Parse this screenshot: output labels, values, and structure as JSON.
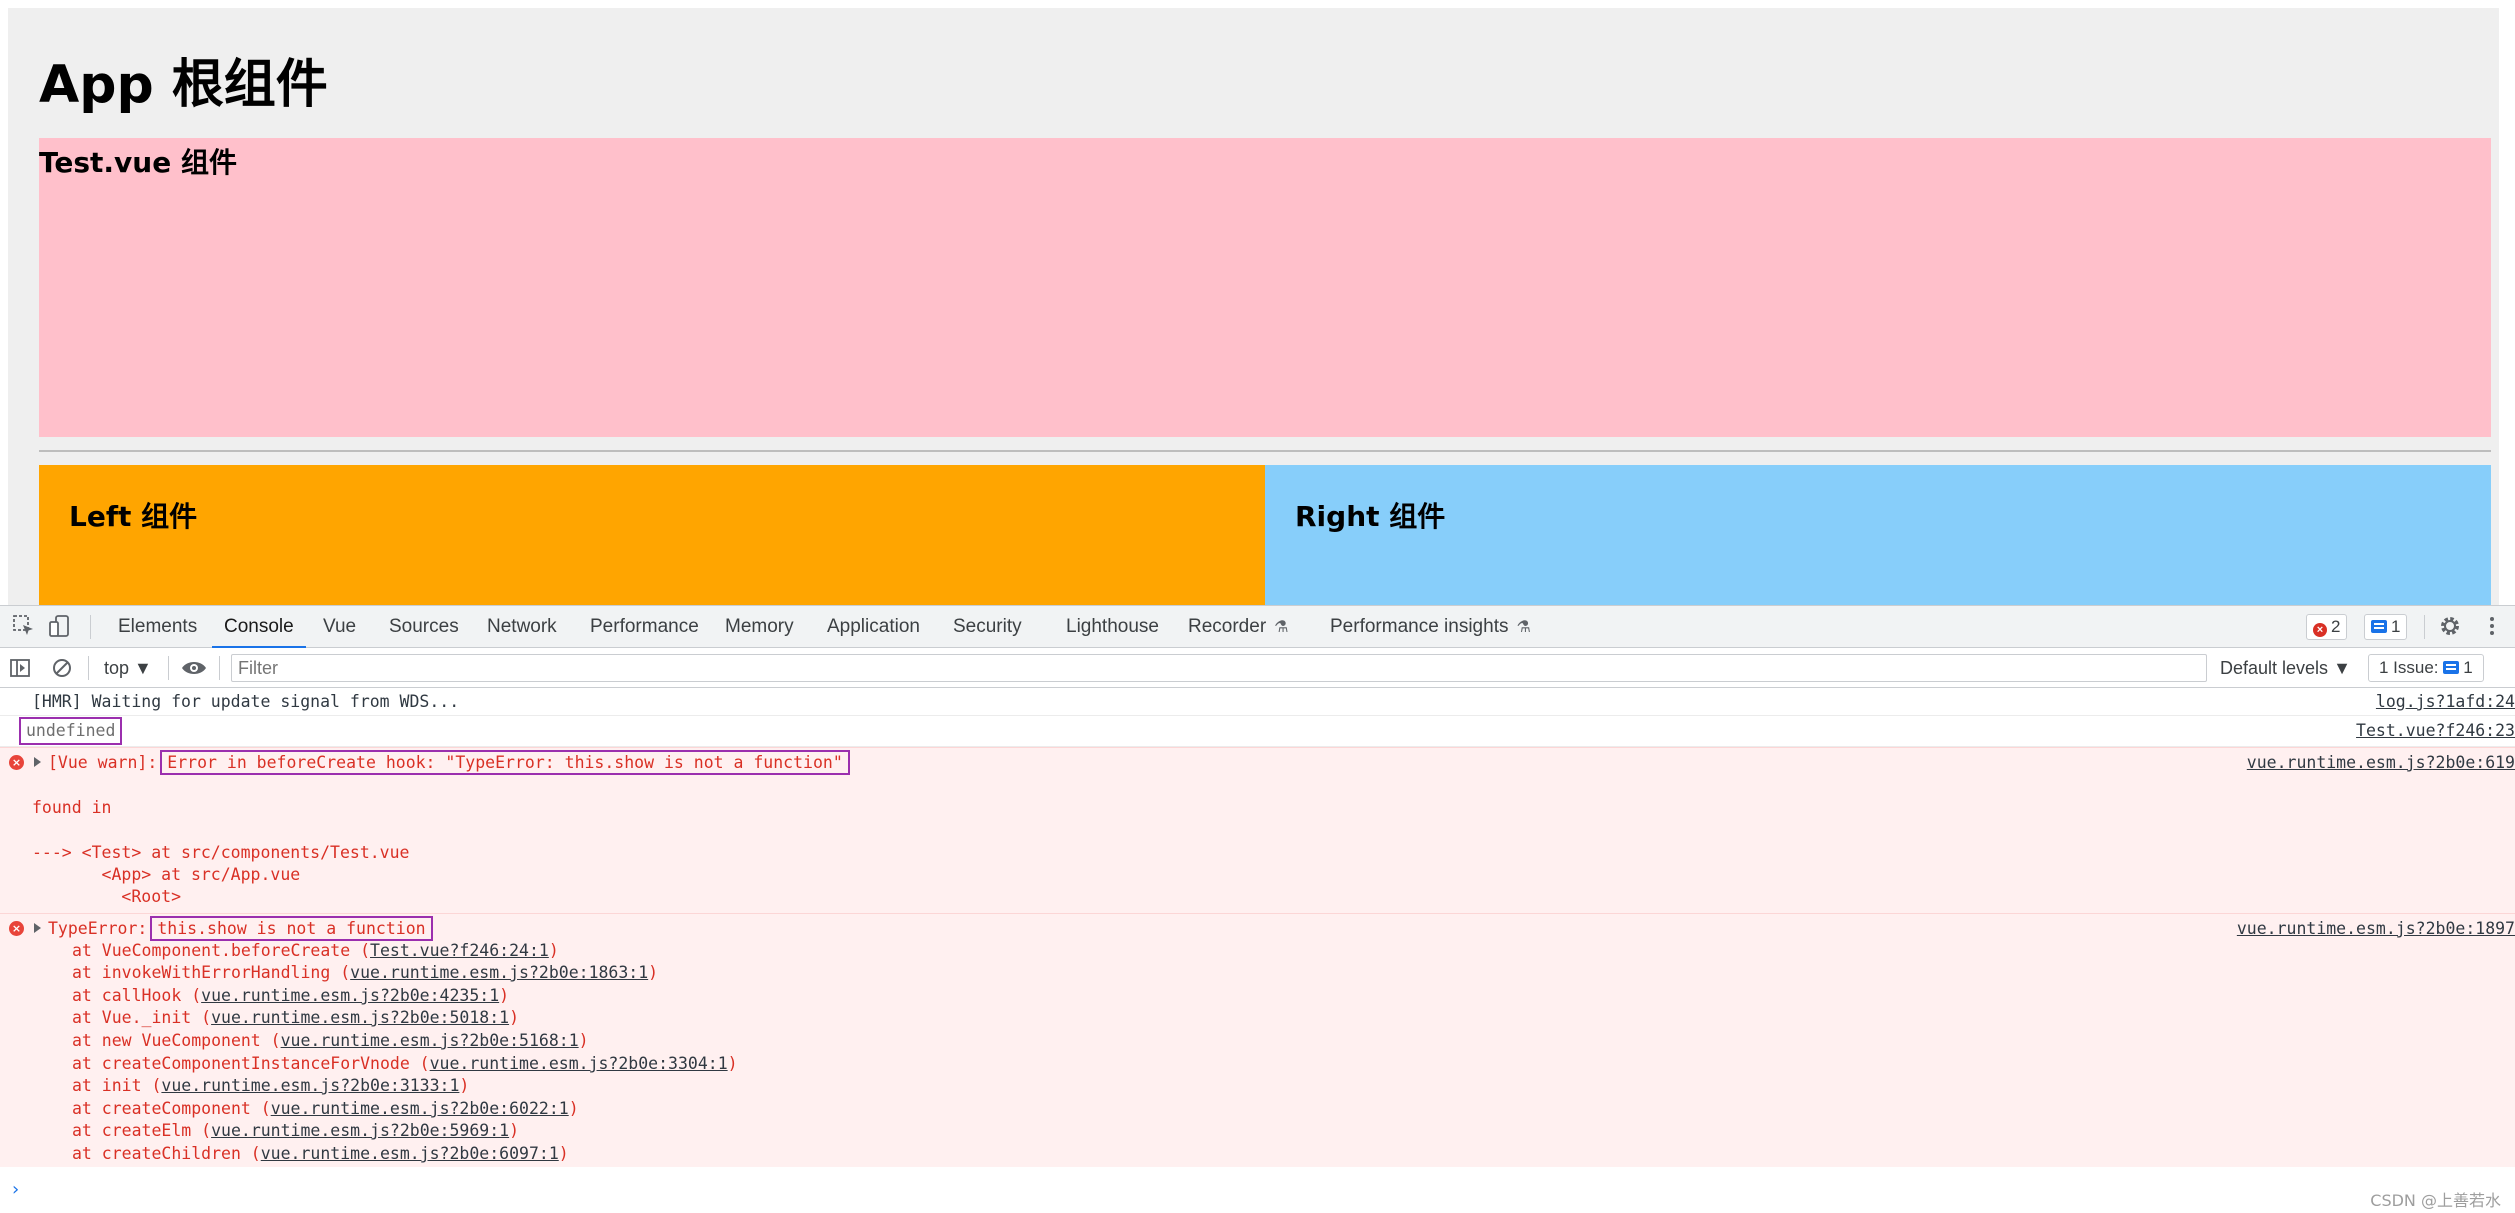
{
  "app": {
    "title": "App 根组件",
    "test_title": "Test.vue 组件",
    "left_title": "Left 组件",
    "right_title": "Right 组件",
    "colors": {
      "app_bg": "#efefef",
      "test_bg": "#ffc0cb",
      "left_bg": "#ffa500",
      "right_bg": "#87cefa"
    }
  },
  "devtools": {
    "tabs": [
      "Elements",
      "Console",
      "Vue",
      "Sources",
      "Network",
      "Performance",
      "Memory",
      "Application",
      "Security",
      "Lighthouse",
      "Recorder",
      "Performance insights"
    ],
    "active_tab": "Console",
    "error_count": "2",
    "message_count": "1",
    "toolbar": {
      "context": "top",
      "filter_placeholder": "Filter",
      "levels": "Default levels",
      "issues_label": "1 Issue:",
      "issues_count": "1"
    },
    "icons": [
      "inspect-icon",
      "device-toggle-icon",
      "settings-gear-icon",
      "more-menu-icon",
      "sidebar-toggle-icon",
      "clear-console-icon",
      "eye-icon",
      "flask-icon"
    ]
  },
  "console": {
    "messages": [
      {
        "text": "[HMR] Waiting for update signal from WDS...",
        "source": "log.js?1afd:24"
      },
      {
        "text": "undefined",
        "source": "Test.vue?f246:23"
      }
    ],
    "warn": {
      "prefix": "[Vue warn]:",
      "message": "Error in beforeCreate hook: \"TypeError: this.show is not a function\"",
      "source": "vue.runtime.esm.js?2b0e:619",
      "found_in": "found in",
      "tree": [
        "---> <Test> at src/components/Test.vue",
        "       <App> at src/App.vue",
        "         <Root>"
      ]
    },
    "error": {
      "prefix": "TypeError:",
      "message": "this.show is not a function",
      "source": "vue.runtime.esm.js?2b0e:1897",
      "stack": [
        {
          "fn": "at VueComponent.beforeCreate (",
          "loc": "Test.vue?f246:24:1"
        },
        {
          "fn": "at invokeWithErrorHandling (",
          "loc": "vue.runtime.esm.js?2b0e:1863:1"
        },
        {
          "fn": "at callHook (",
          "loc": "vue.runtime.esm.js?2b0e:4235:1"
        },
        {
          "fn": "at Vue._init (",
          "loc": "vue.runtime.esm.js?2b0e:5018:1"
        },
        {
          "fn": "at new VueComponent (",
          "loc": "vue.runtime.esm.js?2b0e:5168:1"
        },
        {
          "fn": "at createComponentInstanceForVnode (",
          "loc": "vue.runtime.esm.js?2b0e:3304:1"
        },
        {
          "fn": "at init (",
          "loc": "vue.runtime.esm.js?2b0e:3133:1"
        },
        {
          "fn": "at createComponent (",
          "loc": "vue.runtime.esm.js?2b0e:6022:1"
        },
        {
          "fn": "at createElm (",
          "loc": "vue.runtime.esm.js?2b0e:5969:1"
        },
        {
          "fn": "at createChildren (",
          "loc": "vue.runtime.esm.js?2b0e:6097:1"
        }
      ]
    },
    "prompt_symbol": "›"
  },
  "watermark": "CSDN @上善若水"
}
